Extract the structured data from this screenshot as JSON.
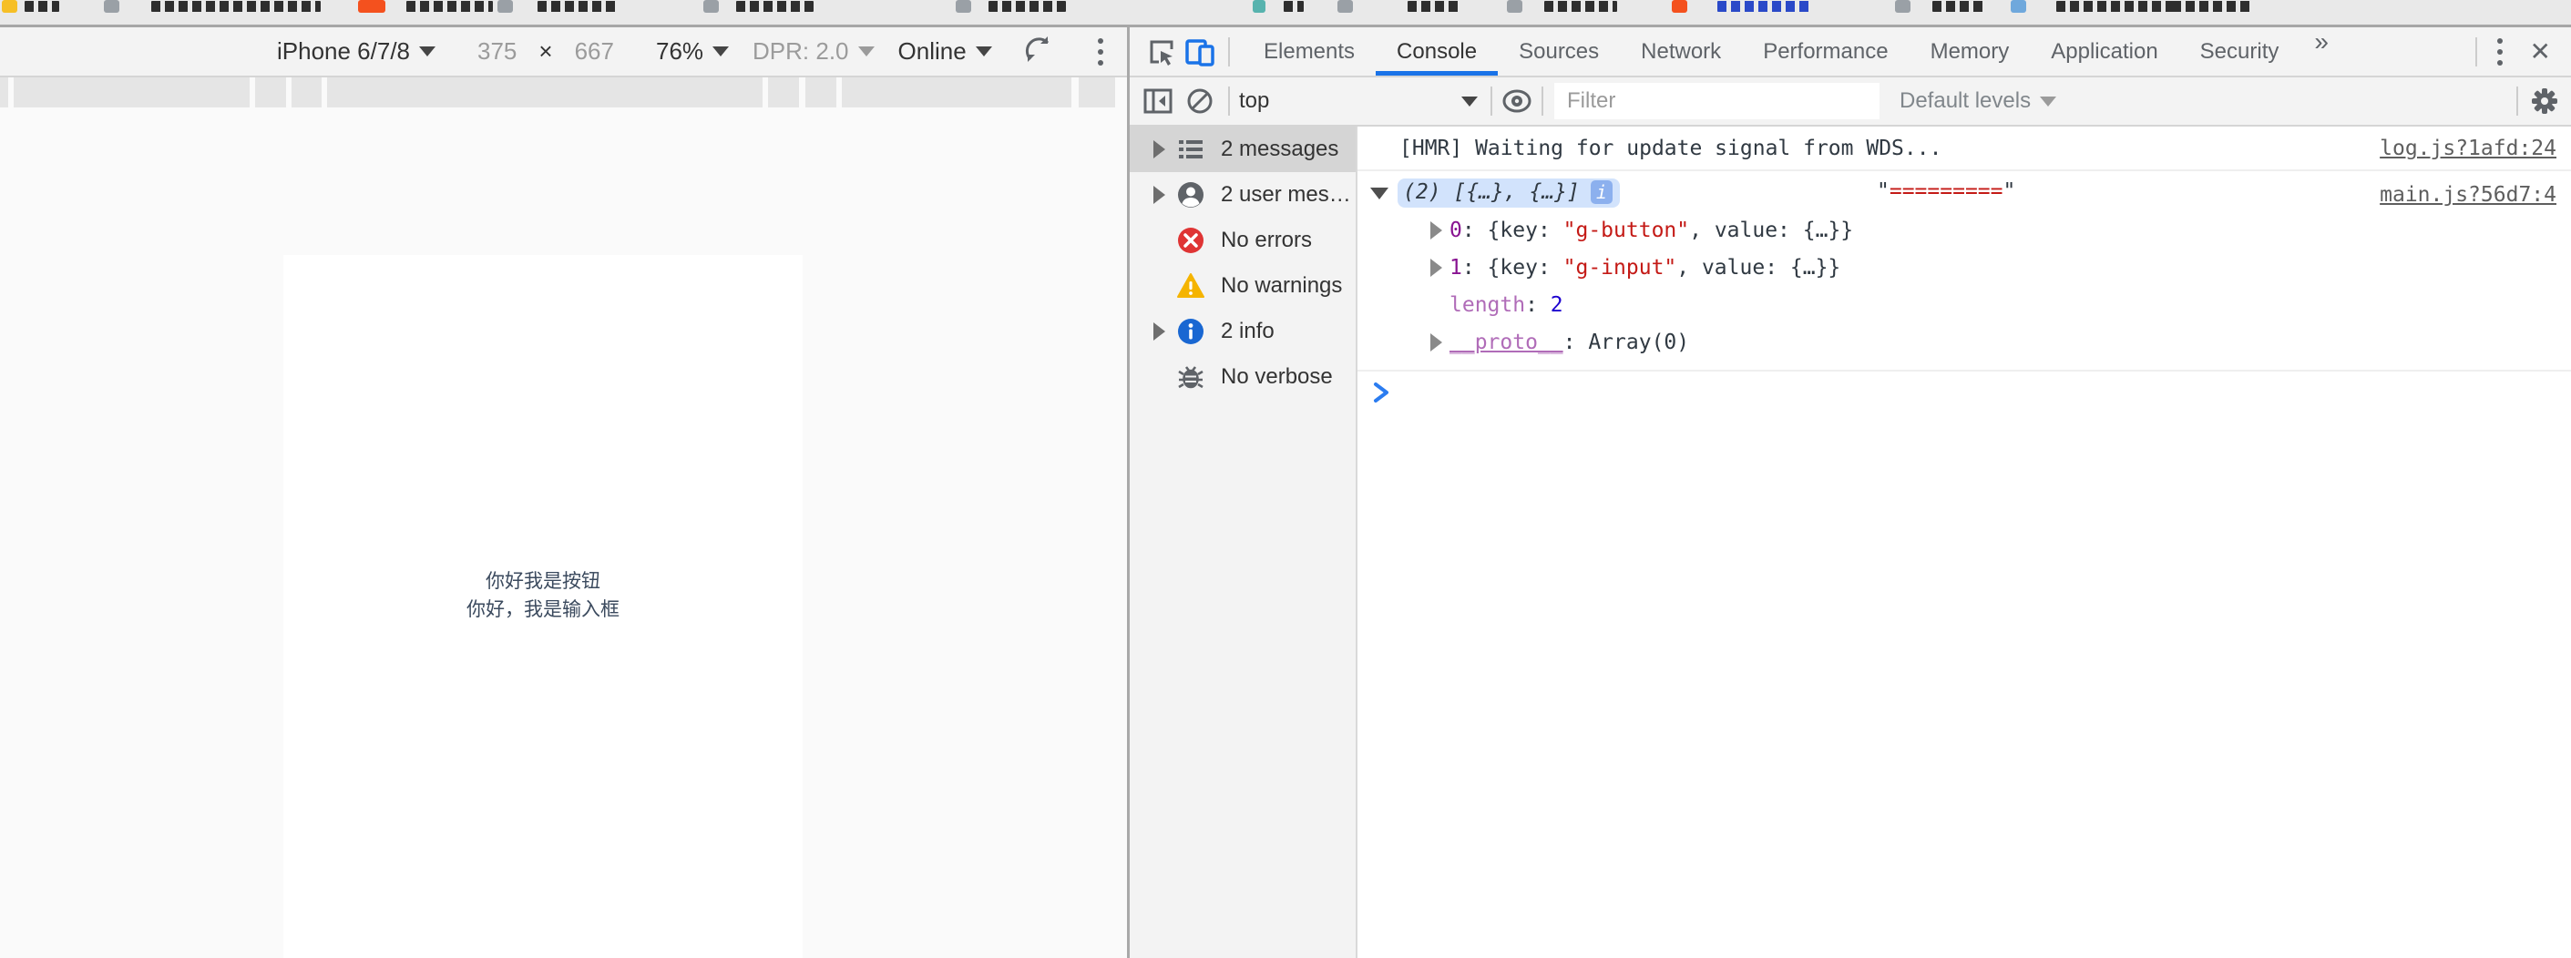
{
  "device_toolbar": {
    "device_label": "iPhone 6/7/8",
    "viewport_width": "375",
    "dimension_separator": "×",
    "viewport_height": "667",
    "zoom_label": "76%",
    "dpr_label": "DPR: 2.0",
    "network_label": "Online"
  },
  "device_page": {
    "line1": "你好我是按钮",
    "line2": "你好，我是输入框"
  },
  "devtools_tabs": {
    "tabs": [
      {
        "label": "Elements"
      },
      {
        "label": "Console"
      },
      {
        "label": "Sources"
      },
      {
        "label": "Network"
      },
      {
        "label": "Performance"
      },
      {
        "label": "Memory"
      },
      {
        "label": "Application"
      },
      {
        "label": "Security"
      }
    ],
    "active_tab": "Console",
    "more_tabs_glyph": "»",
    "close_glyph": "✕"
  },
  "console_toolbar": {
    "context_label": "top",
    "filter_placeholder": "Filter",
    "levels_label": "Default levels"
  },
  "console_sidebar": {
    "items": [
      {
        "label": "2 messages"
      },
      {
        "label": "2 user mes…"
      },
      {
        "label": "No errors"
      },
      {
        "label": "No warnings"
      },
      {
        "label": "2 info"
      },
      {
        "label": "No verbose"
      }
    ]
  },
  "console_log": {
    "hmr_text": "[HMR] Waiting for update signal from WDS...",
    "hmr_source": "log.js?1afd:24",
    "array_preview": "(2) [{…}, {…}]",
    "info_badge_glyph": "i",
    "quote_glyph": "\"",
    "string_arg_value": "=========",
    "array_source": "main.js?56d7:4",
    "item0_index": "0",
    "item0_pre": ": {key: ",
    "item0_string": "\"g-button\"",
    "item0_post": ", value: {…}}",
    "item1_index": "1",
    "item1_pre": ": {key: ",
    "item1_string": "\"g-input\"",
    "item1_post": ", value: {…}}",
    "length_name": "length",
    "length_sep": ": ",
    "length_value": "2",
    "proto_name": "__proto__",
    "proto_sep": ": ",
    "proto_value": "Array(0)"
  },
  "colors": {
    "accent_blue": "#1a73e8",
    "string_red": "#c41a16",
    "index_purple": "#881391",
    "number_blue": "#1c00cf",
    "error_red": "#df3434",
    "warning_amber": "#f5b400",
    "info_blue": "#1967d2"
  }
}
